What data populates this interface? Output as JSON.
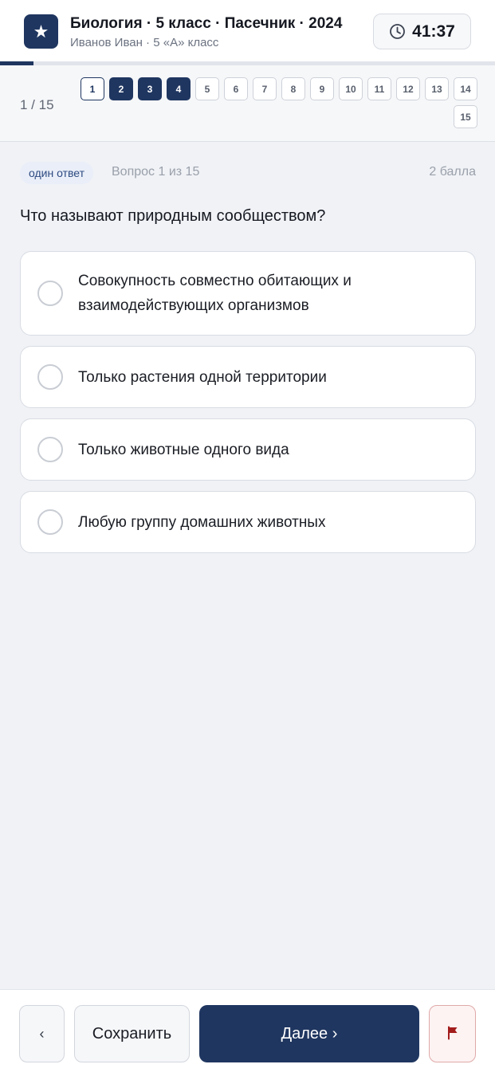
{
  "header": {
    "title": "Биология · 5 класс · Пасечник · 2024",
    "subtitle": "Иванов Иван · 5 «А» класс",
    "timer": "41:37"
  },
  "progress": {
    "current": 1,
    "total": 15,
    "fraction": 0.068
  },
  "nav": {
    "counter": "1 / 15",
    "questions": [
      {
        "label": "1",
        "state": "current"
      },
      {
        "label": "2",
        "state": "answered"
      },
      {
        "label": "3",
        "state": "answered"
      },
      {
        "label": "4",
        "state": "answered"
      },
      {
        "label": "5",
        "state": "empty"
      },
      {
        "label": "6",
        "state": "empty"
      },
      {
        "label": "7",
        "state": "empty"
      },
      {
        "label": "8",
        "state": "empty"
      },
      {
        "label": "9",
        "state": "empty"
      },
      {
        "label": "10",
        "state": "empty"
      },
      {
        "label": "11",
        "state": "empty"
      },
      {
        "label": "12",
        "state": "empty"
      },
      {
        "label": "13",
        "state": "empty"
      },
      {
        "label": "14",
        "state": "empty"
      },
      {
        "label": "15",
        "state": "empty"
      }
    ]
  },
  "question": {
    "type_badge": "один ответ",
    "number_label": "Вопрос 1 из 15",
    "points": "2 балла",
    "text": "Что называют природным сообществом?",
    "answers": [
      "Совокупность совместно обитающих и взаимодействующих организмов",
      "Только растения одной территории",
      "Только животные одного вида",
      "Любую группу домашних животных"
    ]
  },
  "footer": {
    "prev_label": "‹",
    "save_label": "Сохранить",
    "next_label": "Далее ›"
  },
  "colors": {
    "primary": "#1f3660",
    "background": "#f0f2f6",
    "flag": "#a31c1c"
  },
  "icons": {
    "logo": "star-icon",
    "timer": "clock-icon",
    "flag": "flag-icon",
    "answer": "radio-icon"
  }
}
